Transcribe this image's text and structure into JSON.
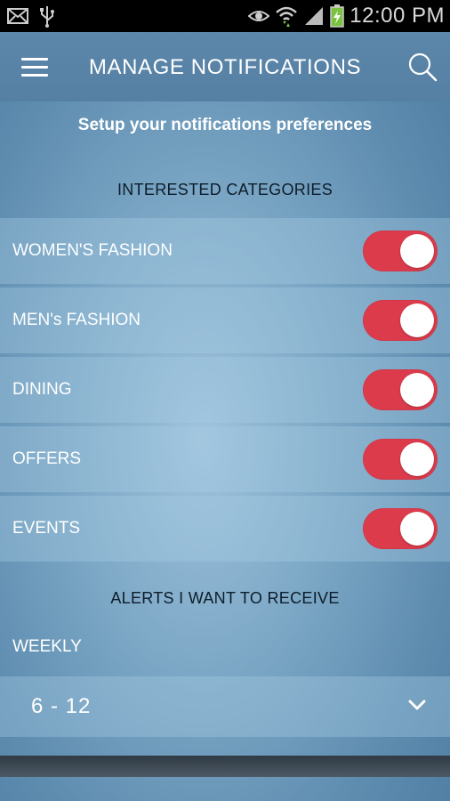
{
  "status_bar": {
    "time": "12:00 PM",
    "icons": [
      "mail-icon",
      "usb-icon",
      "eye-icon",
      "wifi-icon",
      "signal-icon",
      "battery-charging-icon"
    ]
  },
  "app_bar": {
    "title": "MANAGE NOTIFICATIONS",
    "menu_icon": "hamburger-menu-icon",
    "search_icon": "search-icon"
  },
  "subtitle": "Setup your notifications preferences",
  "categories_section": {
    "title": "INTERESTED CATEGORIES",
    "items": [
      {
        "label": "WOMEN'S FASHION",
        "enabled": true
      },
      {
        "label": "MEN's FASHION",
        "enabled": true
      },
      {
        "label": "DINING",
        "enabled": true
      },
      {
        "label": "OFFERS",
        "enabled": true
      },
      {
        "label": "EVENTS",
        "enabled": true
      }
    ]
  },
  "alerts_section": {
    "title": "ALERTS I WANT TO RECEIVE",
    "frequency_label": "WEEKLY",
    "selected_value": "6 - 12"
  },
  "colors": {
    "toggle_on": "#dc3b4c",
    "app_bar": "#5c87aa",
    "status_bar": "#000000"
  }
}
